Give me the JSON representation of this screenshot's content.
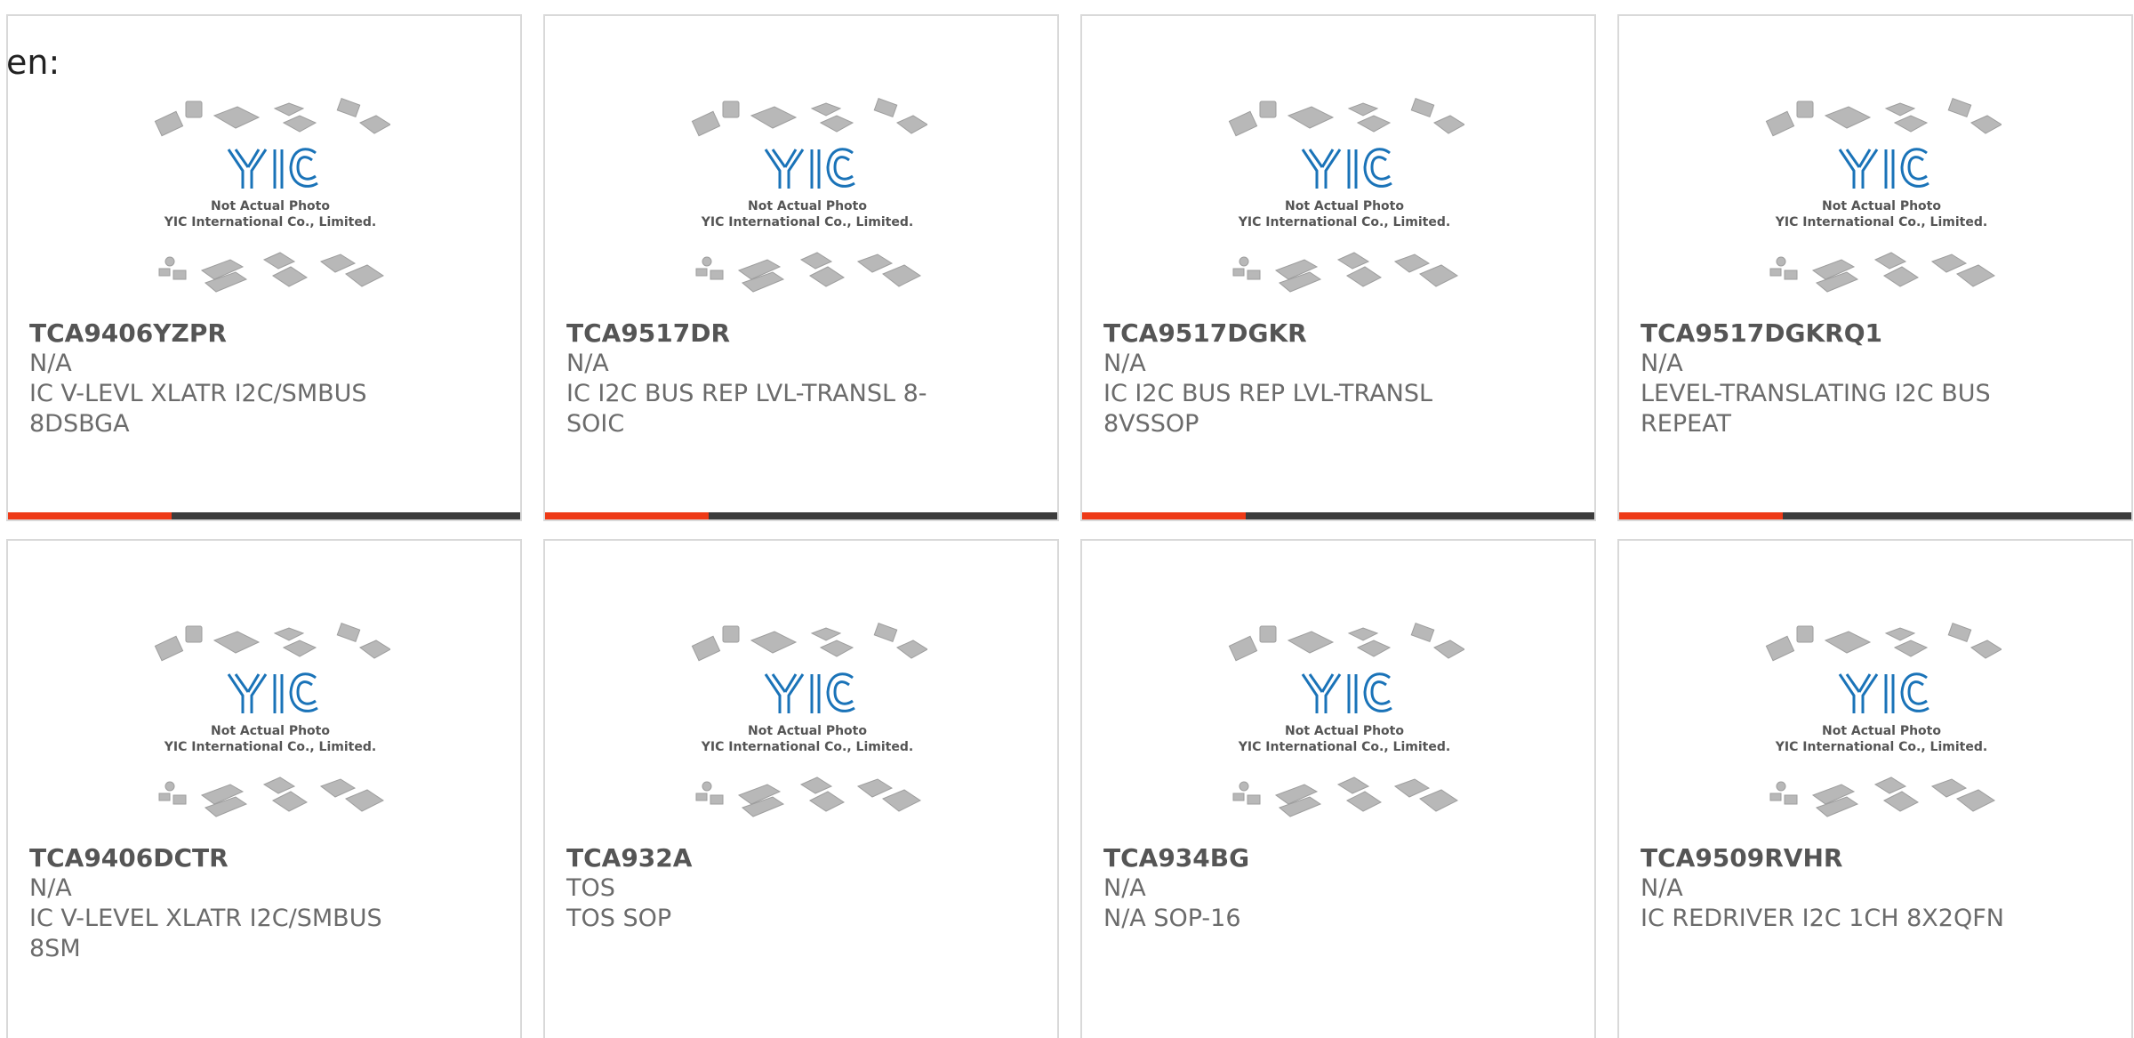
{
  "language_label": "en:",
  "photo": {
    "caption_line1": "Not Actual Photo",
    "caption_line2": "YIC International Co., Limited.",
    "logo_text": "YIC",
    "logo_color": "#1a73b8",
    "chip_color": "#b8b8b8"
  },
  "colors": {
    "accent": "#ee3a17",
    "bar_dark": "#3c3c3c",
    "card_border": "#d9d9d9"
  },
  "products": [
    {
      "part": "TCA9406YZPR",
      "manufacturer": "N/A",
      "description": "IC V-LEVL XLATR I2C/SMBUS 8DSBGA",
      "progress": 0.32
    },
    {
      "part": "TCA9517DR",
      "manufacturer": "N/A",
      "description": "IC I2C BUS REP LVL-TRANSL 8-SOIC",
      "progress": 0.32
    },
    {
      "part": "TCA9517DGKR",
      "manufacturer": "N/A",
      "description": "IC I2C BUS REP LVL-TRANSL 8VSSOP",
      "progress": 0.32
    },
    {
      "part": "TCA9517DGKRQ1",
      "manufacturer": "N/A",
      "description": "LEVEL-TRANSLATING I2C BUS REPEAT",
      "progress": 0.32
    },
    {
      "part": "TCA9406DCTR",
      "manufacturer": "N/A",
      "description": "IC V-LEVEL XLATR I2C/SMBUS 8SM"
    },
    {
      "part": "TCA932A",
      "manufacturer": "TOS",
      "description": "TOS SOP"
    },
    {
      "part": "TCA934BG",
      "manufacturer": "N/A",
      "description": "N/A SOP-16"
    },
    {
      "part": "TCA9509RVHR",
      "manufacturer": "N/A",
      "description": "IC REDRIVER I2C 1CH 8X2QFN"
    }
  ]
}
